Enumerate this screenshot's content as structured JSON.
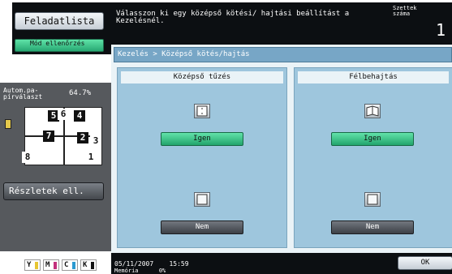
{
  "left_panel": {
    "job_list_button": "Feladatlista",
    "check_button": "Mód ellenőrzés",
    "auto_paper_label": "Autom.pa-\npírválaszt",
    "zoom": "64.7%",
    "page_numbers": [
      "5",
      "6",
      "4",
      "7",
      "2",
      "3",
      "8",
      "1"
    ],
    "details_button": "Részletek ell.",
    "toner": [
      {
        "label": "Y",
        "color": "#e6c532"
      },
      {
        "label": "M",
        "color": "#c2307c"
      },
      {
        "label": "C",
        "color": "#2c9ad0"
      },
      {
        "label": "K",
        "color": "#111111"
      }
    ]
  },
  "header": {
    "message": "Válasszon ki egy középső kötési/ hajtási beállítást a Kezelésnél.",
    "sets_label": "Szettek száma",
    "sets_count": "1"
  },
  "breadcrumb": "Kezelés > Középső kötés/hajtás",
  "columns": [
    {
      "title": "Középső tűzés",
      "yes_label": "Igen",
      "no_label": "Nem",
      "selected": "yes"
    },
    {
      "title": "Félbehajtás",
      "yes_label": "Igen",
      "no_label": "Nem",
      "selected": "yes"
    }
  ],
  "status_bar": {
    "date": "05/11/2007",
    "time": "15:59",
    "memory_label": "Memória",
    "memory_value": "0%",
    "ok_label": "OK"
  }
}
